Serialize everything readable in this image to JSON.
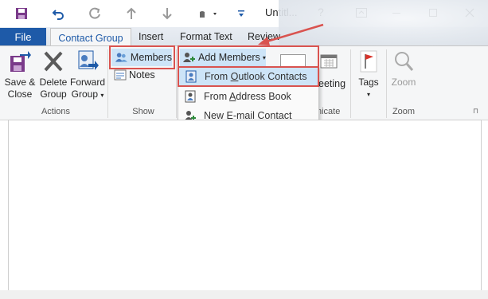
{
  "window": {
    "title": "Untitl...",
    "help": "?"
  },
  "tabs": {
    "file": "File",
    "contact_group": "Contact Group",
    "insert": "Insert",
    "format_text": "Format Text",
    "review": "Review"
  },
  "ribbon": {
    "actions": {
      "save_close_1": "Save &",
      "save_close_2": "Close",
      "delete_1": "Delete",
      "delete_2": "Group",
      "forward_1": "Forward",
      "forward_2": "Group",
      "label": "Actions"
    },
    "show": {
      "members": "Members",
      "notes": "Notes",
      "label": "Show"
    },
    "add_members": {
      "label": "Add Members"
    },
    "communicate": {
      "meeting": "eeting",
      "label": "nicate"
    },
    "tags": {
      "label_btn": "Tags"
    },
    "zoom": {
      "btn": "Zoom",
      "label": "Zoom"
    }
  },
  "dropdown": {
    "items": [
      {
        "pre": "From ",
        "u": "O",
        "post": "utlook Contacts"
      },
      {
        "pre": "From ",
        "u": "A",
        "post": "ddress Book"
      },
      {
        "pre": "New ",
        "u": "E",
        "post": "-mail Contact"
      }
    ]
  },
  "colors": {
    "accent": "#1e5aa8",
    "highlight": "#d9534f",
    "hover": "#cde4f7"
  }
}
